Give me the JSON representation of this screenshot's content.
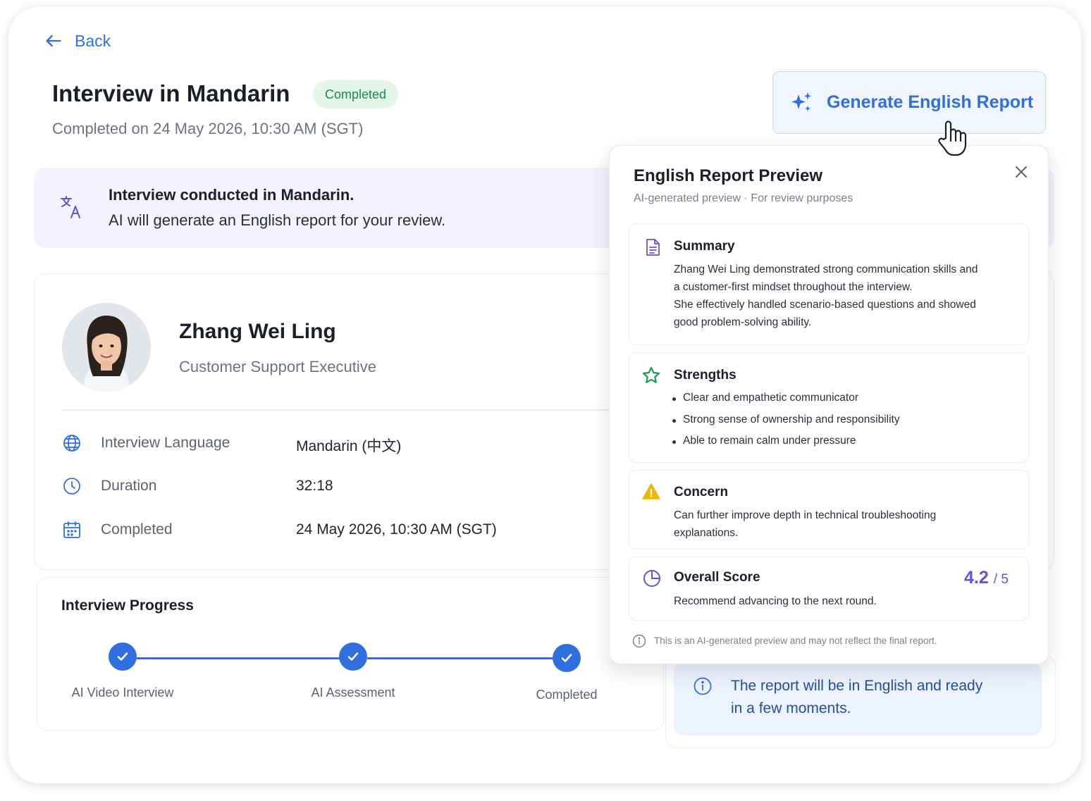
{
  "nav": {
    "back_label": "Back"
  },
  "header": {
    "title": "Interview in Mandarin",
    "status_badge": "Completed",
    "subtitle": "Completed on 24 May 2026, 10:30 AM (SGT)",
    "generate_button": "Generate English Report"
  },
  "banner": {
    "title": "Interview conducted in Mandarin.",
    "text": "AI will generate an English report for your review."
  },
  "candidate": {
    "name": "Zhang Wei Ling",
    "role": "Customer Support Executive",
    "details": [
      {
        "icon": "globe-icon",
        "label": "Interview Language",
        "value": "Mandarin (中文)"
      },
      {
        "icon": "clock-icon",
        "label": "Duration",
        "value": "32:18"
      },
      {
        "icon": "calendar-icon",
        "label": "Completed",
        "value": "24 May 2026, 10:30 AM (SGT)"
      }
    ]
  },
  "progress": {
    "title": "Interview Progress",
    "steps": [
      "AI Video Interview",
      "AI Assessment",
      "Completed"
    ]
  },
  "pending": {
    "text": "The report will be in English and ready in a few moments."
  },
  "preview": {
    "title": "English Report Preview",
    "subtitle": "AI-generated preview · For review purposes",
    "summary": {
      "title": "Summary",
      "lines": [
        "Zhang Wei Ling demonstrated strong communication skills and",
        "a customer-first mindset throughout the interview.",
        "She effectively handled scenario-based questions and showed",
        "good problem-solving ability."
      ]
    },
    "strengths": {
      "title": "Strengths",
      "items": [
        "Clear and empathetic communicator",
        "Strong sense of ownership and responsibility",
        "Able to remain calm under pressure"
      ]
    },
    "concern": {
      "title": "Concern",
      "lines": [
        "Can further improve depth in technical troubleshooting",
        "explanations."
      ]
    },
    "score": {
      "title": "Overall Score",
      "value": "4.2",
      "max": "/ 5",
      "text": "Recommend advancing to the next round."
    },
    "disclaimer": "This is an AI-generated preview and may not reflect the final report."
  },
  "colors": {
    "accent": "#2f6fe0",
    "success": "#1f8a4c",
    "score": "#6b4fd8",
    "warning": "#f2b500"
  }
}
